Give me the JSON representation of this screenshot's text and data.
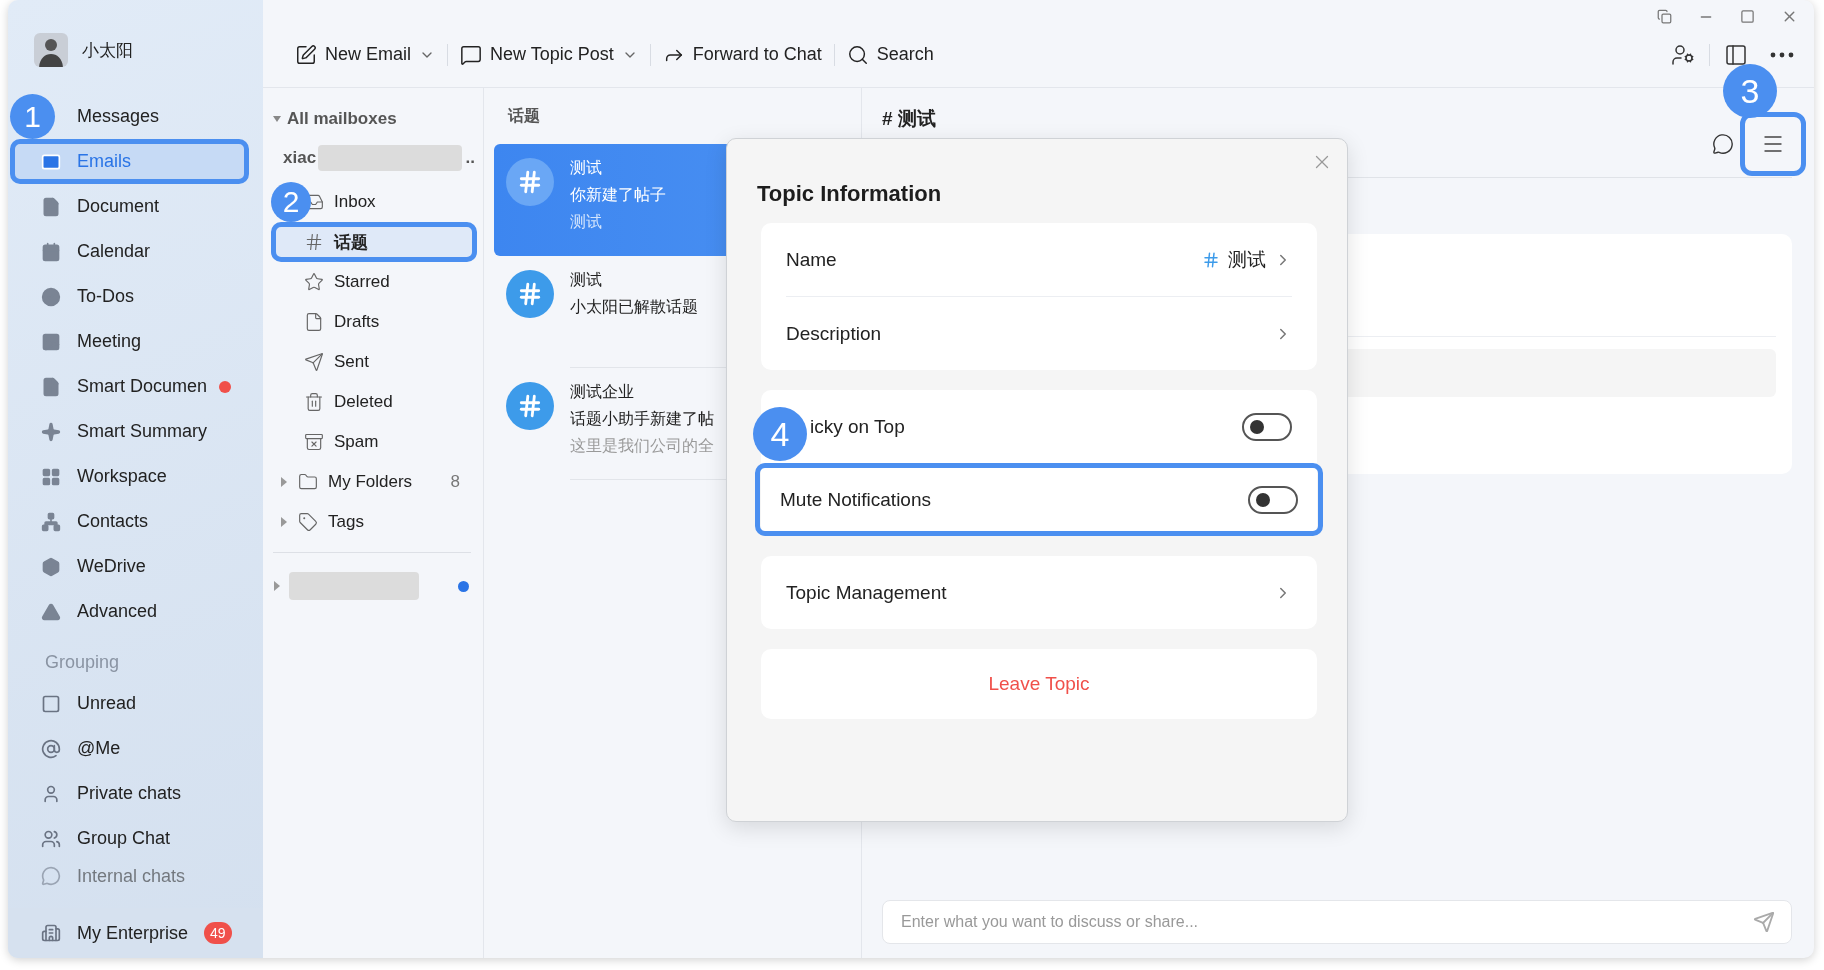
{
  "profile": {
    "name": "小太阳"
  },
  "sidebar": {
    "items": [
      {
        "label": "Messages",
        "selected": false,
        "highlighted": false
      },
      {
        "label": "Emails",
        "selected": true,
        "highlighted": true
      },
      {
        "label": "Document",
        "selected": false,
        "highlighted": false
      },
      {
        "label": "Calendar",
        "selected": false,
        "highlighted": false
      },
      {
        "label": "To-Dos",
        "selected": false,
        "highlighted": false
      },
      {
        "label": "Meeting",
        "selected": false,
        "highlighted": false
      },
      {
        "label": "Smart Documen",
        "selected": false,
        "highlighted": false,
        "dot": true
      },
      {
        "label": "Smart Summary",
        "selected": false,
        "highlighted": false
      },
      {
        "label": "Workspace",
        "selected": false,
        "highlighted": false
      },
      {
        "label": "Contacts",
        "selected": false,
        "highlighted": false
      },
      {
        "label": "WeDrive",
        "selected": false,
        "highlighted": false
      },
      {
        "label": "Advanced",
        "selected": false,
        "highlighted": false
      }
    ],
    "group_heading": "Grouping",
    "group_items": [
      {
        "label": "Unread"
      },
      {
        "label": "@Me"
      },
      {
        "label": "Private chats"
      },
      {
        "label": "Group Chat"
      },
      {
        "label": "Internal chats"
      }
    ],
    "footer": {
      "label": "My Enterprise",
      "badge": "49"
    }
  },
  "toolbar": {
    "items": [
      {
        "label": "New Email",
        "dropdown": true
      },
      {
        "label": "New Topic Post",
        "dropdown": true
      },
      {
        "label": "Forward to Chat",
        "dropdown": false
      },
      {
        "label": "Search",
        "dropdown": false
      }
    ]
  },
  "mailboxes": {
    "heading": "All mailboxes",
    "expanded": true,
    "account": {
      "name": "xiac",
      "suffix": ".."
    },
    "folders": [
      {
        "label": "Inbox",
        "selected": false,
        "highlighted": false
      },
      {
        "label": "话题",
        "selected": true,
        "highlighted": true
      },
      {
        "label": "Starred",
        "selected": false,
        "highlighted": false
      },
      {
        "label": "Drafts",
        "selected": false,
        "highlighted": false
      },
      {
        "label": "Sent",
        "selected": false,
        "highlighted": false
      },
      {
        "label": "Deleted",
        "selected": false,
        "highlighted": false
      },
      {
        "label": "Spam",
        "selected": false,
        "highlighted": false
      },
      {
        "label": "My Folders",
        "selected": false,
        "highlighted": false,
        "expanded": false,
        "count": "8"
      },
      {
        "label": "Tags",
        "selected": false,
        "highlighted": false,
        "expanded": false
      }
    ],
    "other_account": {
      "expanded": false,
      "unread": true
    }
  },
  "topic_list": {
    "heading": "话题",
    "items": [
      {
        "title": "测试",
        "line2": "你新建了帖子",
        "line3": "测试",
        "selected": true
      },
      {
        "title": "测试",
        "line2": "小太阳已解散话题",
        "selected": false
      },
      {
        "title": "测试企业",
        "line2": "话题小助手新建了帖",
        "line3": "这里是我们公司的全",
        "selected": false
      }
    ]
  },
  "conversation": {
    "title": "# 测试",
    "menu_highlighted": true,
    "composer": {
      "placeholder": "Enter what you want to discuss or share..."
    }
  },
  "topic_dialog": {
    "title": "Topic Information",
    "sections": [
      {
        "rows": [
          {
            "kind": "link",
            "label": "Name",
            "value": "测试"
          },
          {
            "kind": "link",
            "label": "Description"
          }
        ]
      },
      {
        "rows": [
          {
            "kind": "toggle",
            "label": "icky on Top",
            "on": false
          },
          {
            "kind": "toggle",
            "label": "Mute Notifications",
            "on": false,
            "highlighted": true
          }
        ]
      },
      {
        "rows": [
          {
            "kind": "link",
            "label": "Topic Management"
          }
        ]
      },
      {
        "rows": [
          {
            "kind": "danger",
            "label": "Leave Topic"
          }
        ]
      }
    ]
  },
  "callouts": [
    "1",
    "2",
    "3",
    "4"
  ]
}
